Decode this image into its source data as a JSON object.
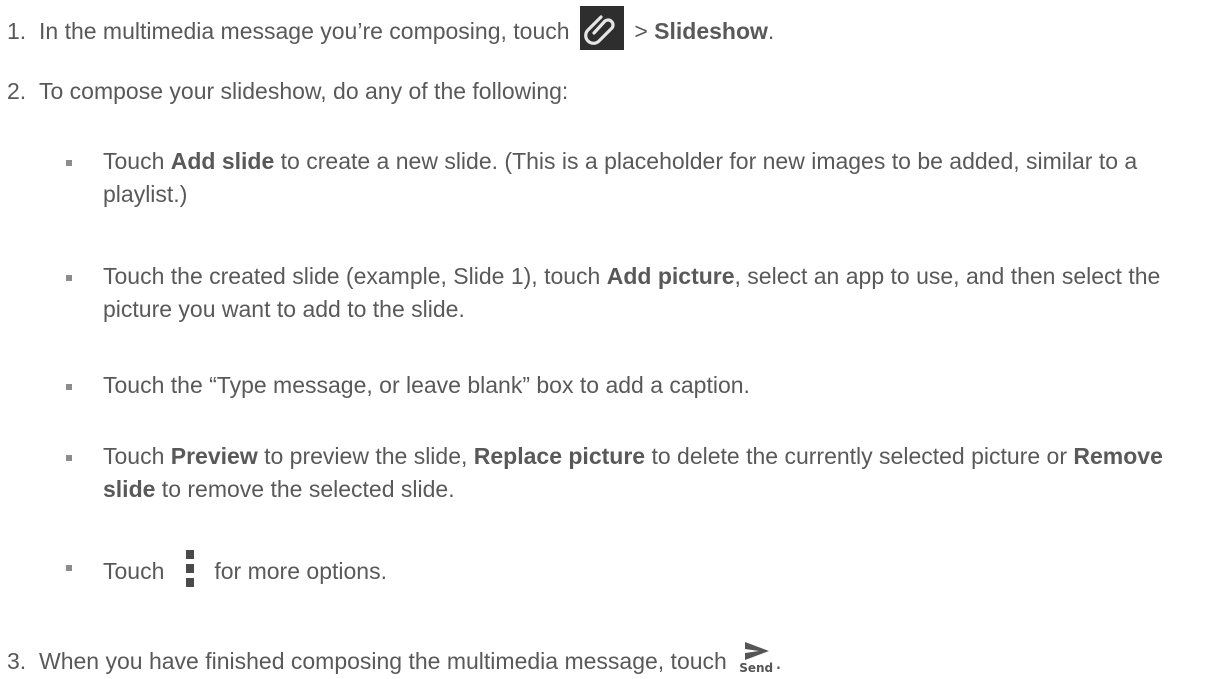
{
  "steps": [
    {
      "number": "1.",
      "text_before": "In the multimedia message you’re composing, touch",
      "text_sep": " > ",
      "bold": "Slideshow",
      "text_after": "."
    },
    {
      "number": "2.",
      "text": "To compose your slideshow, do any of the following:"
    },
    {
      "number": "3.",
      "text_before": "When you have finished composing the multimedia message, touch",
      "send_label": "Send",
      "text_after": "."
    }
  ],
  "bullets": [
    {
      "pre": "Touch ",
      "bold": "Add slide",
      "post": " to create a new slide. (This is a placeholder for new images to be added, similar to a playlist.)"
    },
    {
      "pre": "Touch the created slide (example, Slide 1), touch ",
      "bold": "Add picture",
      "post": ", select an app to use, and then select the picture you want to add to the slide."
    },
    {
      "text": "Touch the “Type message, or leave blank” box to add a caption."
    },
    {
      "pre": "Touch ",
      "bold1": "Preview",
      "mid1": " to preview the slide, ",
      "bold2": "Replace picture",
      "mid2": " to delete the currently selected picture or ",
      "bold3": "Remove slide",
      "post": " to remove the selected slide."
    },
    {
      "pre": "Touch",
      "post": "for more options."
    }
  ],
  "icons": {
    "attach": "paperclip-icon",
    "more": "overflow-menu-icon",
    "send": "send-icon"
  }
}
